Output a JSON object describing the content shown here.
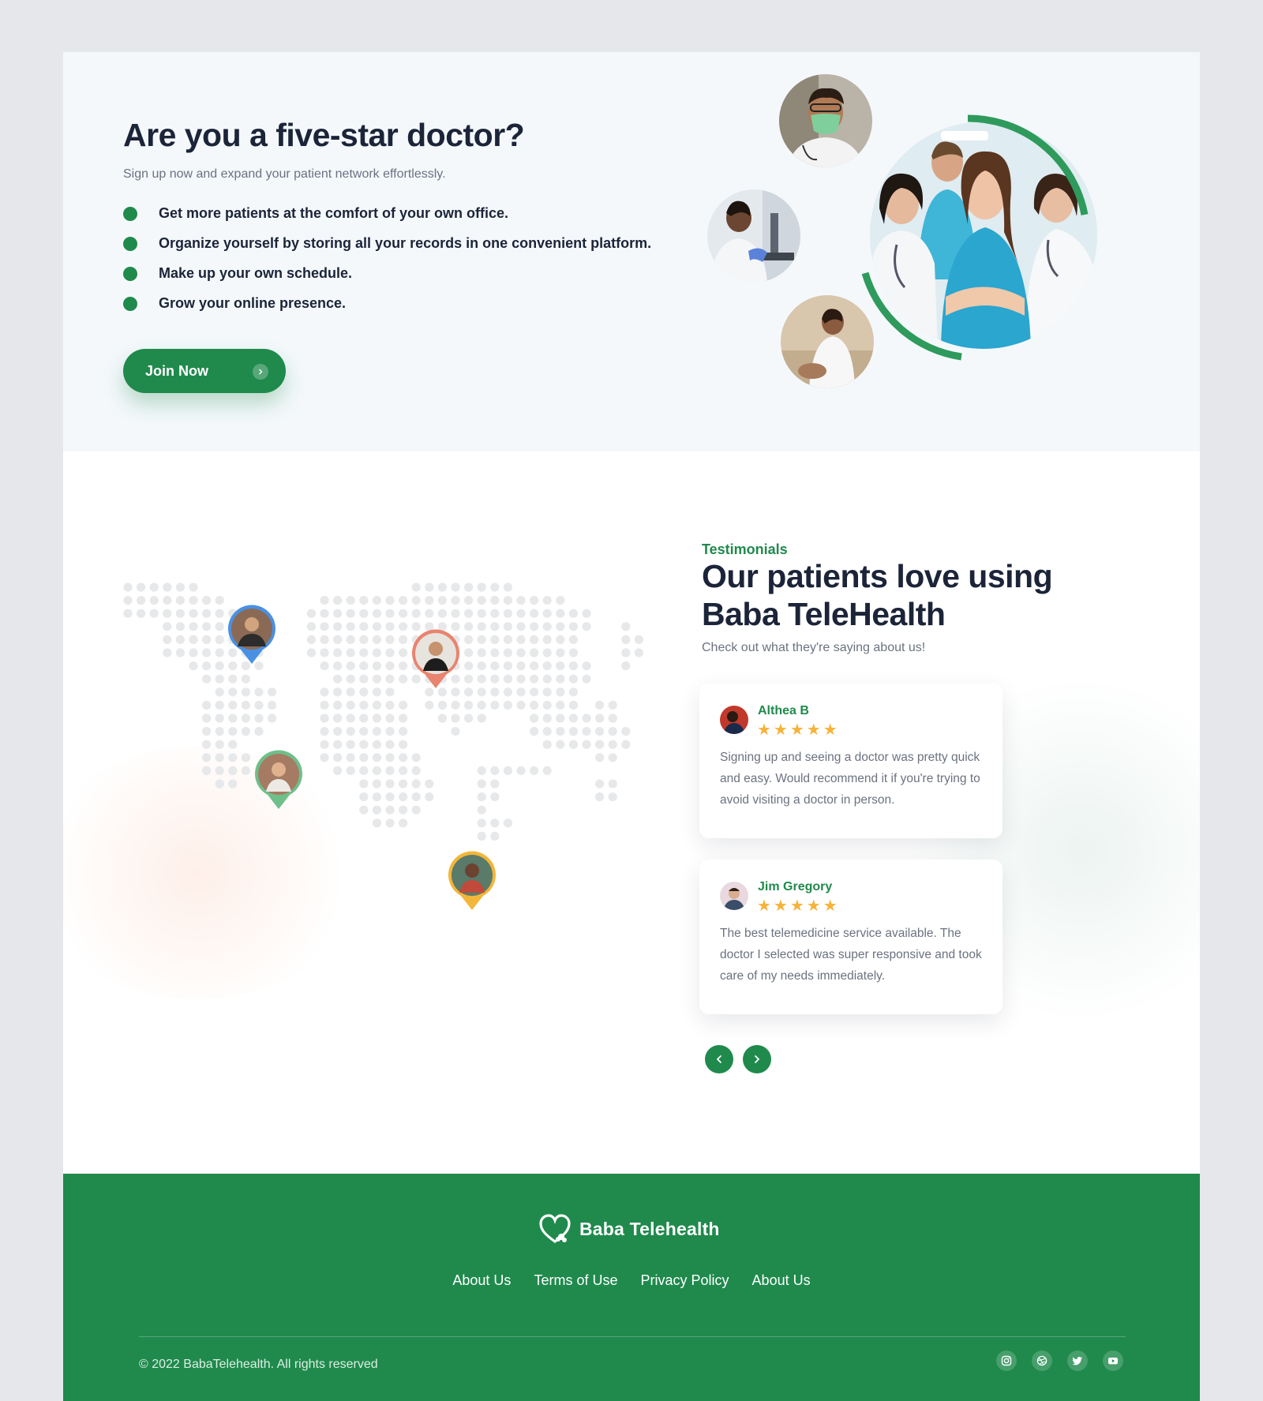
{
  "hero": {
    "title": "Are you a five-star doctor?",
    "subtitle": "Sign up now and expand your patient network effortlessly.",
    "bullets": [
      "Get more patients at the comfort of your own office.",
      "Organize yourself by storing all your records in one convenient platform.",
      "Make up your own schedule.",
      "Grow your online presence."
    ],
    "cta_label": "Join Now"
  },
  "testimonials": {
    "eyebrow": "Testimonials",
    "title": "Our patients love using Baba TeleHealth",
    "subtitle": "Check out what they're saying about us!",
    "items": [
      {
        "name": "Althea B",
        "stars": "★★★★★",
        "text": "Signing up and seeing a doctor was pretty quick and easy. Would recommend it if you're trying to avoid visiting a doctor in person."
      },
      {
        "name": "Jim Gregory",
        "stars": "★★★★★",
        "text": "The best telemedicine service available. The doctor I selected was super responsive and took care of my needs immediately."
      }
    ],
    "rating": 5
  },
  "footer": {
    "brand": "Baba Telehealth",
    "links": [
      "About Us",
      "Terms of Use",
      "Privacy Policy",
      "About Us"
    ],
    "copyright": "© 2022 BabaTelehealth. All rights reserved",
    "socials": [
      "instagram-icon",
      "dribbble-icon",
      "twitter-icon",
      "youtube-icon"
    ]
  },
  "colors": {
    "brand_green": "#1f8a4c",
    "navy": "#1b2438",
    "star": "#f6b23a",
    "hero_bg": "#f4f8fb",
    "pin_blue": "#4a90e2",
    "pin_coral": "#e8846f",
    "pin_green": "#6fbf8a",
    "pin_yellow": "#f2b63a"
  }
}
